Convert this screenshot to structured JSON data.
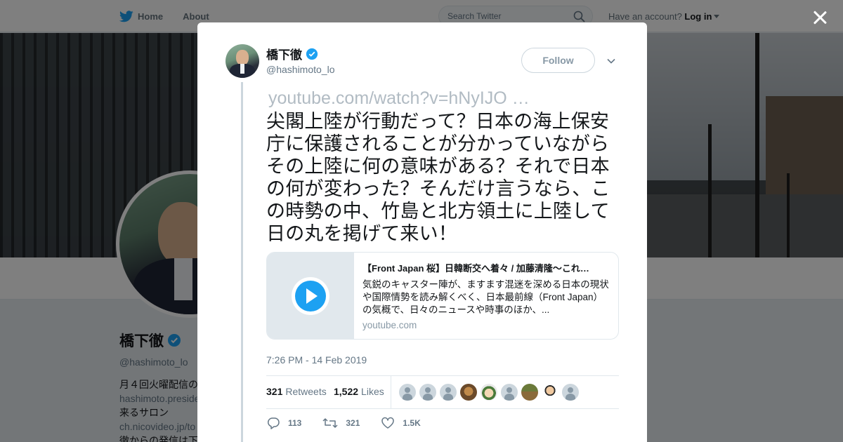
{
  "nav": {
    "home_label": "Home",
    "about_label": "About",
    "search_placeholder": "Search Twitter",
    "have_account": "Have an account?",
    "login_label": "Log in"
  },
  "profile": {
    "name": "橋下徹",
    "handle": "@hashimoto_lo",
    "bio_line1": "月４回火曜配信の",
    "bio_link1": "hashimoto.preside",
    "bio_line2": "来るサロン",
    "bio_link2": "ch.nicovideo.jp/to",
    "bio_line3": "徹からの発信は下"
  },
  "tweet": {
    "author_name": "橋下徹",
    "author_handle": "@hashimoto_lo",
    "follow_label": "Follow",
    "link_text": "youtube.com/watch?v=hNyIJO …",
    "text": "尖閣上陸が行動だって？日本の海上保安庁に保護されることが分かっていながらその上陸に何の意味がある？それで日本の何が変わった？そんだけ言うなら、この時勢の中、竹島と北方領土に上陸して日の丸を掲げて来い！",
    "card": {
      "title": "【Front Japan 桜】日韓断交へ着々 / 加藤清隆～これ…",
      "description": "気鋭のキャスター陣が、ますます混迷を深める日本の現状や国際情勢を読み解くべく、日本最前線（Front Japan）の気概で、日々のニュースや時事のほか、...",
      "domain": "youtube.com"
    },
    "timestamp": "7:26 PM - 14 Feb 2019",
    "retweets_count": "321",
    "retweets_label": "Retweets",
    "likes_count": "1,522",
    "likes_label": "Likes",
    "replies_action": "113",
    "retweets_action": "321",
    "likes_action": "1.5K"
  },
  "colors": {
    "accent": "#1da1f2",
    "muted": "#657786",
    "border": "#e1e8ed"
  }
}
